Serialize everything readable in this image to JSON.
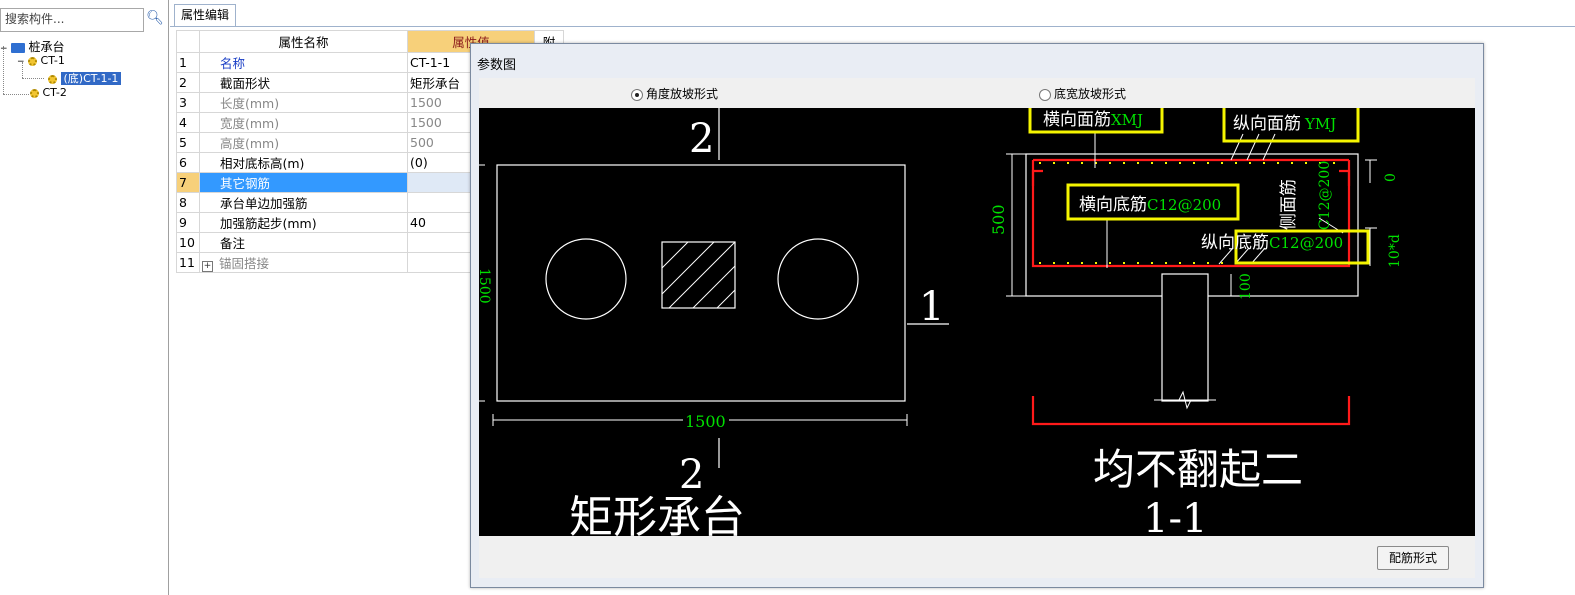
{
  "left_panel": {
    "search_placeholder": "搜索构件...",
    "tree": {
      "root": "桩承台",
      "child1": "CT-1",
      "child1_1": "(底)CT-1-1",
      "child2": "CT-2"
    }
  },
  "tab": {
    "label": "属性编辑"
  },
  "grid": {
    "header_name": "属性名称",
    "header_value": "属性值",
    "header_extra": "附",
    "rows": [
      {
        "num": "1",
        "name": "名称",
        "value": "CT-1-1"
      },
      {
        "num": "2",
        "name": "截面形状",
        "value": "矩形承台"
      },
      {
        "num": "3",
        "name": "长度(mm)",
        "value": "1500"
      },
      {
        "num": "4",
        "name": "宽度(mm)",
        "value": "1500"
      },
      {
        "num": "5",
        "name": "高度(mm)",
        "value": "500"
      },
      {
        "num": "6",
        "name": "相对底标高(m)",
        "value": "(0)"
      },
      {
        "num": "7",
        "name": "其它钢筋",
        "value": ""
      },
      {
        "num": "8",
        "name": "承台单边加强筋",
        "value": ""
      },
      {
        "num": "9",
        "name": "加强筋起步(mm)",
        "value": "40"
      },
      {
        "num": "10",
        "name": "备注",
        "value": ""
      },
      {
        "num": "11",
        "name": "锚固搭接",
        "value": ""
      }
    ]
  },
  "dialog": {
    "title": "参数图",
    "radio_angle": "角度放坡形式",
    "radio_width": "底宽放坡形式",
    "button_rebar": "配筋形式"
  },
  "drawing": {
    "section_marker_top": "2",
    "section_marker_bottom": "2",
    "section_marker_right": "1",
    "dim_length": "1500",
    "dim_width_partial": "1500",
    "plan_title": "矩形承台",
    "xmj_label": "横向面筋",
    "xmj_value": "XMJ",
    "ymj_label": "纵向面筋",
    "ymj_value": "YMJ",
    "xbottom_label": "横向底筋",
    "xbottom_value": "C12@200",
    "ybottom_label": "纵向底筋",
    "ybottom_value": "C12@200",
    "side_label": "侧面筋",
    "side_value": "C12@200",
    "dim_height": "500",
    "dim_zero": "0",
    "dim_10d": "10*d",
    "dim_100": "100",
    "section_note": "均不翻起二",
    "section_title": "1-1",
    "colors": {
      "green": "#00e000",
      "yellow": "#f5f500",
      "red": "#ff1a1a",
      "white": "#ffffff"
    }
  }
}
